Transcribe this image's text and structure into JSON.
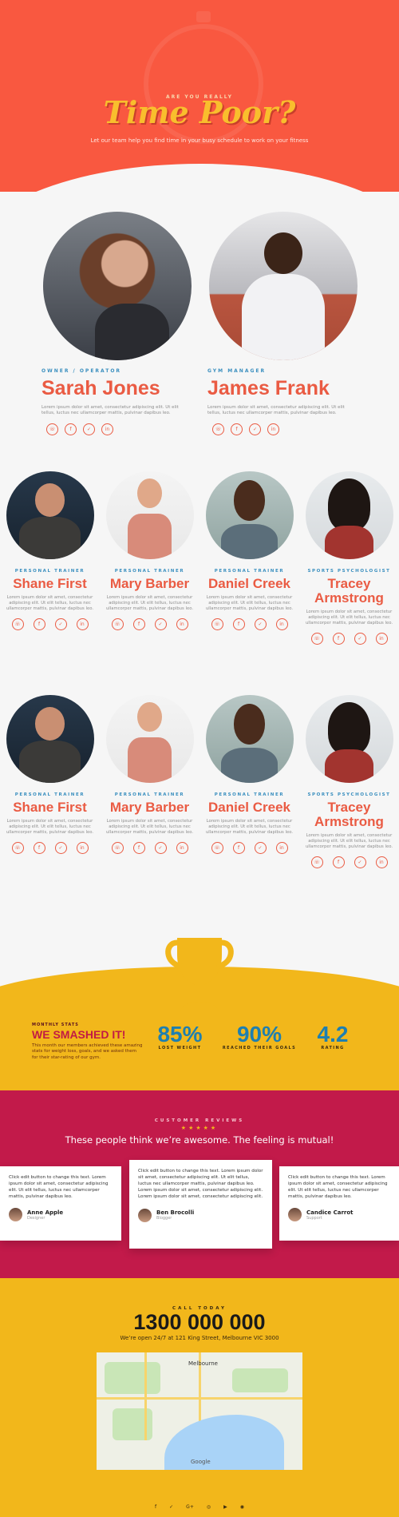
{
  "hero": {
    "eyebrow": "ARE YOU REALLY",
    "title": "Time Poor?",
    "subtitle": "Let our team help you find time in your busy schedule to work on your fitness"
  },
  "leaders": [
    {
      "role": "OWNER / OPERATOR",
      "name": "Sarah Jones",
      "bio": "Lorem ipsum dolor sit amet, consectetur adipiscing elit. Ut elit tellus, luctus nec ullamcorper mattis, pulvinar dapibus leo."
    },
    {
      "role": "GYM MANAGER",
      "name": "James Frank",
      "bio": "Lorem ipsum dolor sit amet, consectetur adipiscing elit. Ut elit tellus, luctus nec ullamcorper mattis, pulvinar dapibus leo."
    }
  ],
  "trainers_row1": [
    {
      "role": "PERSONAL TRAINER",
      "name": "Shane First",
      "bio": "Lorem ipsum dolor sit amet, consectetur adipiscing elit. Ut elit tellus, luctus nec ullamcorper mattis, pulvinar dapibus leo."
    },
    {
      "role": "PERSONAL TRAINER",
      "name": "Mary Barber",
      "bio": "Lorem ipsum dolor sit amet, consectetur adipiscing elit. Ut elit tellus, luctus nec ullamcorper mattis, pulvinar dapibus leo."
    },
    {
      "role": "PERSONAL TRAINER",
      "name": "Daniel Creek",
      "bio": "Lorem ipsum dolor sit amet, consectetur adipiscing elit. Ut elit tellus, luctus nec ullamcorper mattis, pulvinar dapibus leo."
    },
    {
      "role": "SPORTS PSYCHOLOGIST",
      "name": "Tracey Armstrong",
      "bio": "Lorem ipsum dolor sit amet, consectetur adipiscing elit. Ut elit tellus, luctus nec ullamcorper mattis, pulvinar dapibus leo."
    }
  ],
  "trainers_row2": [
    {
      "role": "PERSONAL TRAINER",
      "name": "Shane First",
      "bio": "Lorem ipsum dolor sit amet, consectetur adipiscing elit. Ut elit tellus, luctus nec ullamcorper mattis, pulvinar dapibus leo."
    },
    {
      "role": "PERSONAL TRAINER",
      "name": "Mary Barber",
      "bio": "Lorem ipsum dolor sit amet, consectetur adipiscing elit. Ut elit tellus, luctus nec ullamcorper mattis, pulvinar dapibus leo."
    },
    {
      "role": "PERSONAL TRAINER",
      "name": "Daniel Creek",
      "bio": "Lorem ipsum dolor sit amet, consectetur adipiscing elit. Ut elit tellus, luctus nec ullamcorper mattis, pulvinar dapibus leo."
    },
    {
      "role": "SPORTS PSYCHOLOGIST",
      "name": "Tracey Armstrong",
      "bio": "Lorem ipsum dolor sit amet, consectetur adipiscing elit. Ut elit tellus, luctus nec ullamcorper mattis, pulvinar dapibus leo."
    }
  ],
  "social_icons": [
    "phone-icon",
    "facebook-icon",
    "twitter-icon",
    "linkedin-icon"
  ],
  "stats": {
    "eyebrow": "MONTHLY STATS",
    "title": "WE SMASHED IT!",
    "description": "This month our members achieved these amazing stats for weight loss, goals, and we asked them for their star-rating of our gym.",
    "items": [
      {
        "value": "85%",
        "label": "LOST WEIGHT"
      },
      {
        "value": "90%",
        "label": "REACHED THEIR GOALS"
      },
      {
        "value": "4.2",
        "label": "RATING"
      }
    ]
  },
  "reviews": {
    "eyebrow": "CUSTOMER REVIEWS",
    "stars": "★★★★★",
    "title": "These people think we’re awesome. The feeling is mutual!",
    "cards": [
      {
        "text": "Click edit button to change this text. Lorem ipsum dolor sit amet, consectetur adipiscing elit. Ut elit tellus, luctus nec ullamcorper mattis, pulvinar dapibus leo.",
        "name": "Anne Apple",
        "role": "Designer"
      },
      {
        "text": "Click edit button to change this text. Lorem ipsum dolor sit amet, consectetur adipiscing elit. Ut elit tellus, luctus nec ullamcorper mattis, pulvinar dapibus leo. Lorem ipsum dolor sit amet, consectetur adipiscing elit. Lorem ipsum dolor sit amet, consectetur adipiscing elit.",
        "name": "Ben Brocolli",
        "role": "Blogger"
      },
      {
        "text": "Click edit button to change this text. Lorem ipsum dolor sit amet, consectetur adipiscing elit. Ut elit tellus, luctus nec ullamcorper mattis, pulvinar dapibus leo.",
        "name": "Candice Carrot",
        "role": "Support"
      }
    ]
  },
  "call": {
    "eyebrow": "CALL TODAY",
    "phone": "1300 000 000",
    "address": "We’re open 24/7 at 121 King Street, Melbourne VIC 3000",
    "map_label": "Melbourne",
    "map_brand": "Google"
  },
  "footer_icons": [
    "f",
    "✓",
    "G+",
    "◎",
    "▶",
    "◉"
  ],
  "colors": {
    "hero": "#f95840",
    "accent": "#ea5b43",
    "yellow": "#f2b71b",
    "crimson": "#c21a4a",
    "blue": "#1e7fb0"
  }
}
